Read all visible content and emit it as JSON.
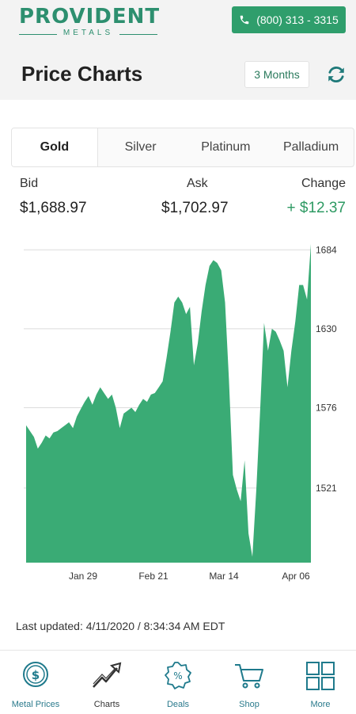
{
  "header": {
    "logo_main": "PROVIDENT",
    "logo_sub": "METALS",
    "phone": "(800) 313 - 3315",
    "title": "Price Charts",
    "range": "3 Months",
    "refresh_icon": "refresh-icon"
  },
  "tabs": [
    {
      "label": "Gold",
      "active": true
    },
    {
      "label": "Silver",
      "active": false
    },
    {
      "label": "Platinum",
      "active": false
    },
    {
      "label": "Palladium",
      "active": false
    }
  ],
  "stats": {
    "bid_label": "Bid",
    "bid_value": "$1,688.97",
    "ask_label": "Ask",
    "ask_value": "$1,702.97",
    "change_label": "Change",
    "change_value": "+ $12.37"
  },
  "chart_data": {
    "type": "area",
    "color": "#3aab75",
    "x_ticks": [
      "Jan 29",
      "Feb 21",
      "Mar 14",
      "Apr 06"
    ],
    "y_ticks": [
      1684,
      1630,
      1576,
      1521
    ],
    "ylim": [
      1470,
      1695
    ],
    "grid": true,
    "y_axis_side": "right",
    "values": [
      1564,
      1560,
      1556,
      1548,
      1552,
      1557,
      1555,
      1559,
      1560,
      1562,
      1564,
      1566,
      1562,
      1570,
      1575,
      1580,
      1584,
      1578,
      1585,
      1590,
      1586,
      1582,
      1585,
      1576,
      1562,
      1572,
      1574,
      1576,
      1573,
      1578,
      1582,
      1580,
      1585,
      1586,
      1590,
      1594,
      1610,
      1628,
      1648,
      1652,
      1648,
      1640,
      1645,
      1605,
      1620,
      1642,
      1660,
      1673,
      1677,
      1675,
      1670,
      1648,
      1595,
      1530,
      1520,
      1512,
      1540,
      1490,
      1474,
      1520,
      1575,
      1634,
      1615,
      1630,
      1628,
      1622,
      1615,
      1590,
      1615,
      1635,
      1660,
      1660,
      1650,
      1688
    ],
    "xlabel": "",
    "ylabel": "",
    "title": ""
  },
  "last_updated": "Last updated: 4/11/2020 / 8:34:34 AM EDT",
  "nav": [
    {
      "label": "Metal Prices",
      "icon": "dollar-coin-icon"
    },
    {
      "label": "Charts",
      "icon": "trend-arrow-icon"
    },
    {
      "label": "Deals",
      "icon": "percent-badge-icon"
    },
    {
      "label": "Shop",
      "icon": "cart-icon"
    },
    {
      "label": "More",
      "icon": "grid-icon"
    }
  ]
}
